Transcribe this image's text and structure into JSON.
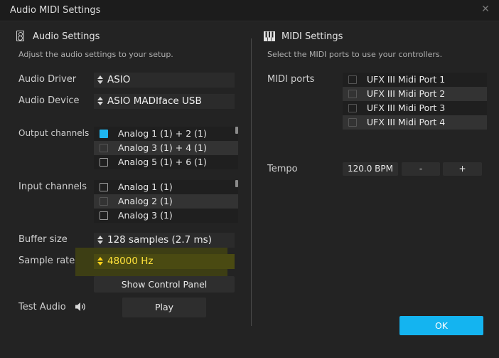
{
  "window": {
    "title": "Audio MIDI Settings",
    "close_glyph": "✕"
  },
  "audio": {
    "title": "Audio Settings",
    "description": "Adjust the audio settings to your setup.",
    "driver_label": "Audio Driver",
    "driver_value": "ASIO",
    "device_label": "Audio Device",
    "device_value": "ASIO MADIface USB",
    "output_label": "Output channels",
    "output_channels": [
      {
        "label": "Analog 1 (1) + 2 (1)",
        "checked": true
      },
      {
        "label": "Analog 3 (1) + 4 (1)",
        "checked": false
      },
      {
        "label": "Analog 5 (1) + 6 (1)",
        "checked": false
      }
    ],
    "input_label": "Input channels",
    "input_channels": [
      {
        "label": "Analog 1 (1)",
        "checked": false
      },
      {
        "label": "Analog 2 (1)",
        "checked": false
      },
      {
        "label": "Analog 3 (1)",
        "checked": false
      }
    ],
    "buffer_label": "Buffer size",
    "buffer_value": "128 samples (2.7 ms)",
    "samplerate_label": "Sample rate",
    "samplerate_value": "48000 Hz",
    "control_panel_label": "Show Control Panel",
    "test_label": "Test Audio",
    "play_label": "Play"
  },
  "midi": {
    "title": "MIDI Settings",
    "description": "Select the MIDI ports to use your controllers.",
    "ports_label": "MIDI ports",
    "ports": [
      {
        "label": "UFX III Midi Port 1",
        "checked": false
      },
      {
        "label": "UFX III Midi Port 2",
        "checked": false
      },
      {
        "label": "UFX III Midi Port 3",
        "checked": false
      },
      {
        "label": "UFX III Midi Port 4",
        "checked": false
      }
    ],
    "tempo_label": "Tempo",
    "tempo_value": "120.0 BPM",
    "tempo_minus": "-",
    "tempo_plus": "+"
  },
  "ok_label": "OK",
  "colors": {
    "accent": "#14b4f0",
    "highlight_text": "#ffe23a",
    "background": "#232323"
  }
}
